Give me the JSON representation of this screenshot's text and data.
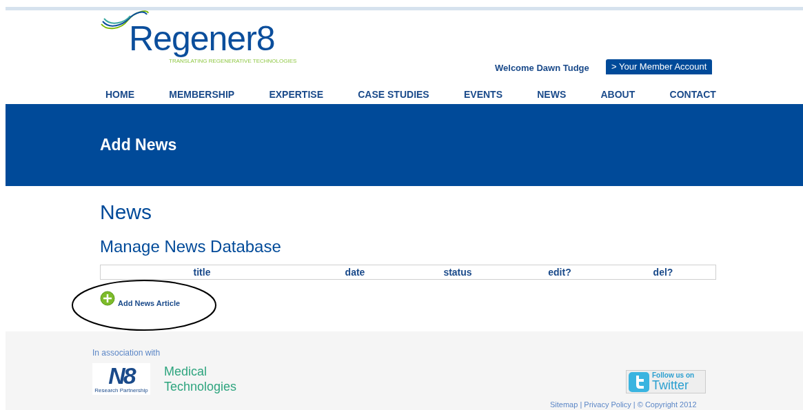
{
  "logo": {
    "name": "Regener8",
    "tagline": "TRANSLATING REGENERATIVE TECHNOLOGIES"
  },
  "welcome": "Welcome Dawn Tudge",
  "account_button": "> Your Member Account",
  "nav": [
    {
      "label": "HOME"
    },
    {
      "label": "MEMBERSHIP"
    },
    {
      "label": "EXPERTISE"
    },
    {
      "label": "CASE STUDIES"
    },
    {
      "label": "EVENTS"
    },
    {
      "label": "NEWS"
    },
    {
      "label": "ABOUT"
    },
    {
      "label": "CONTACT"
    }
  ],
  "banner_title": "Add News",
  "heading": "News",
  "subheading": "Manage News Database",
  "table": {
    "columns": [
      "title",
      "date",
      "status",
      "edit?",
      "del?"
    ]
  },
  "add_link": "Add News Article",
  "footer": {
    "association": "In association with",
    "partner_logo": {
      "mark": "N8",
      "caption": "Research Partnership"
    },
    "partner_name": [
      "Medical",
      "Technologies"
    ],
    "twitter": {
      "line1": "Follow us on",
      "line2": "Twitter"
    },
    "links": "Sitemap | Privacy Policy | © Copyright 2012"
  }
}
